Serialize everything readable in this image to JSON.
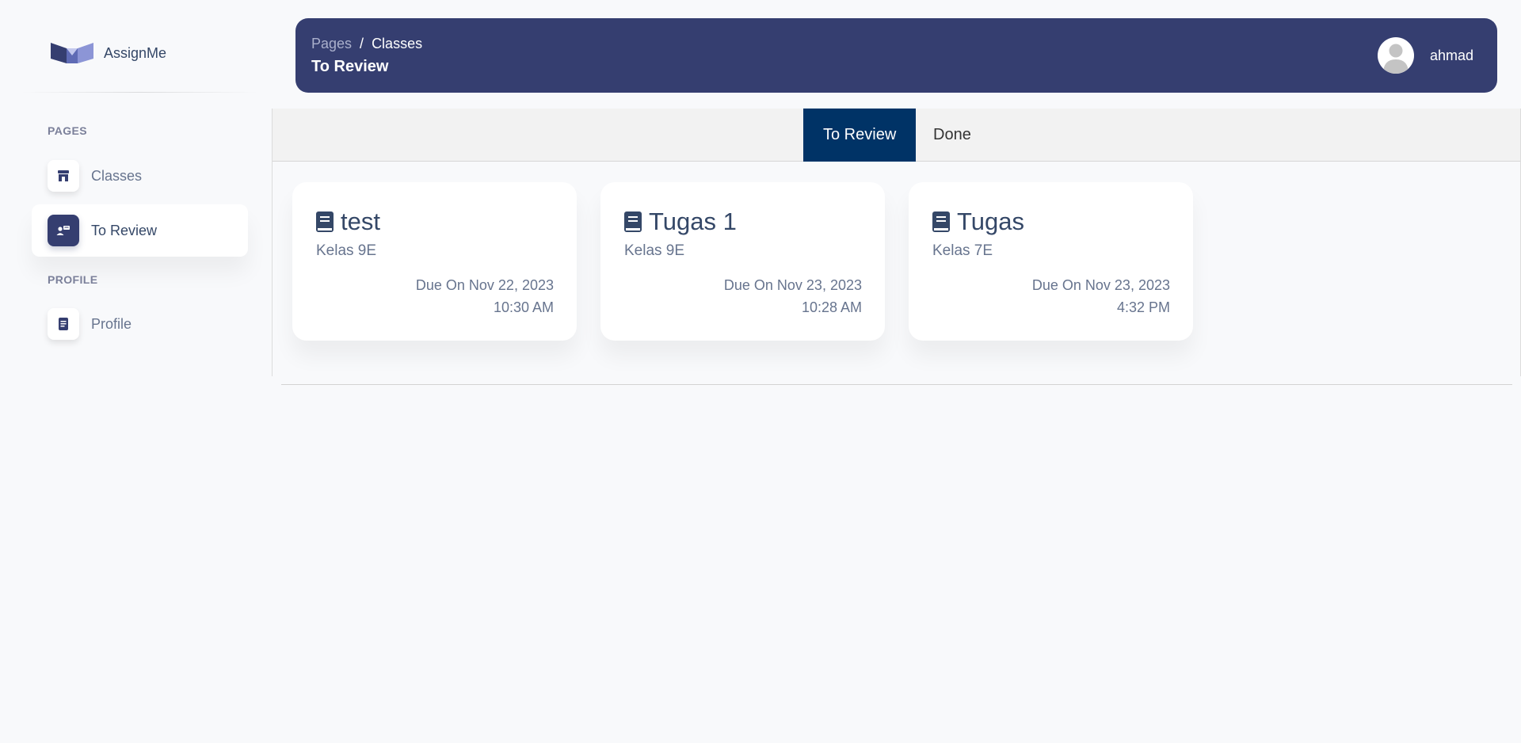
{
  "brand": {
    "name": "AssignMe"
  },
  "sidebar": {
    "sections": [
      {
        "label": "PAGES"
      },
      {
        "label": "PROFILE"
      }
    ],
    "items": [
      {
        "label": "Classes",
        "icon": "store-icon"
      },
      {
        "label": "To Review",
        "icon": "review-icon"
      },
      {
        "label": "Profile",
        "icon": "document-icon"
      }
    ]
  },
  "header": {
    "breadcrumb": {
      "root": "Pages",
      "separator": "/",
      "current": "Classes"
    },
    "title": "To Review",
    "user": {
      "name": "ahmad"
    }
  },
  "tabs": [
    {
      "label": "To Review",
      "active": true
    },
    {
      "label": "Done",
      "active": false
    }
  ],
  "cards": [
    {
      "title": "test",
      "class": "Kelas 9E",
      "due_date": "Due On Nov 22, 2023",
      "due_time": "10:30 AM"
    },
    {
      "title": "Tugas 1",
      "class": "Kelas 9E",
      "due_date": "Due On Nov 23, 2023",
      "due_time": "10:28 AM"
    },
    {
      "title": "Tugas",
      "class": "Kelas 7E",
      "due_date": "Due On Nov 23, 2023",
      "due_time": "4:32 PM"
    }
  ],
  "colors": {
    "header_bg": "#353e70",
    "active_tab": "#003366",
    "text_dark": "#344767",
    "text_muted": "#67748e"
  }
}
